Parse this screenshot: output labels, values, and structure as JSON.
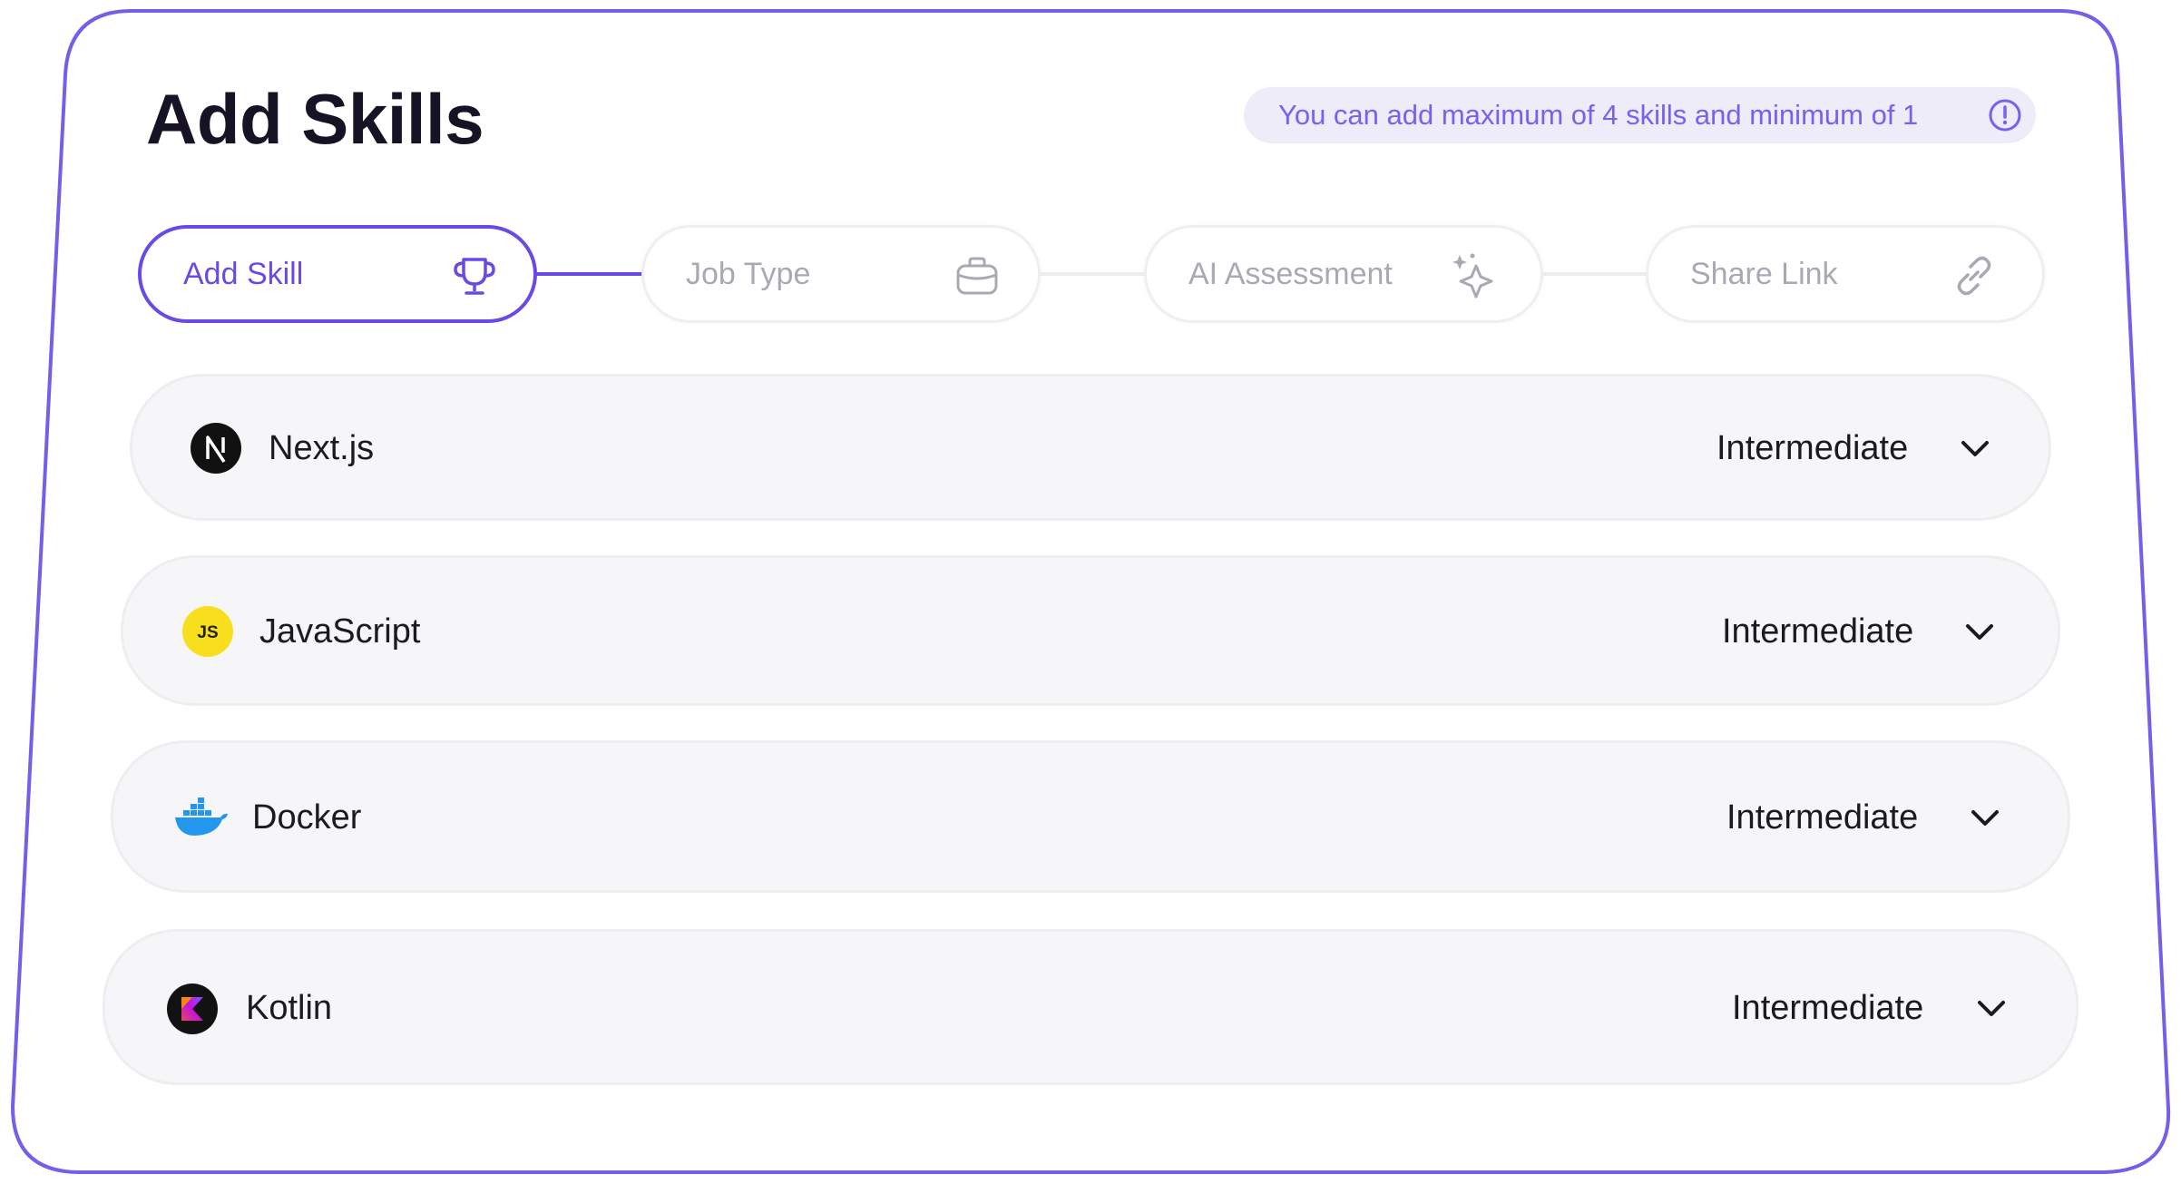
{
  "page": {
    "title": "Add Skills",
    "info": "You can add maximum of 4 skills and minimum of 1",
    "info_icon": "exclamation-circle-icon"
  },
  "steps": [
    {
      "label": "Add Skill",
      "icon": "trophy-icon",
      "state": "active"
    },
    {
      "label": "Job Type",
      "icon": "briefcase-icon",
      "state": "inactive"
    },
    {
      "label": "AI Assessment",
      "icon": "sparkles-icon",
      "state": "inactive"
    },
    {
      "label": "Share Link",
      "icon": "link-icon",
      "state": "inactive"
    }
  ],
  "skills": [
    {
      "name": "Next.js",
      "logo": "nextjs-logo",
      "level": "Intermediate"
    },
    {
      "name": "JavaScript",
      "logo": "javascript-logo",
      "logo_text": "JS",
      "level": "Intermediate"
    },
    {
      "name": "Docker",
      "logo": "docker-logo",
      "level": "Intermediate"
    },
    {
      "name": "Kotlin",
      "logo": "kotlin-logo",
      "level": "Intermediate"
    }
  ],
  "colors": {
    "accent": "#6a4ae6",
    "info_background": "#efecfa",
    "info_text": "#7a5ff0",
    "row_background": "#f6f6f8",
    "inactive_text": "#a8a9b4",
    "javascript_yellow": "#f7df1e",
    "docker_blue": "#2396ed"
  }
}
